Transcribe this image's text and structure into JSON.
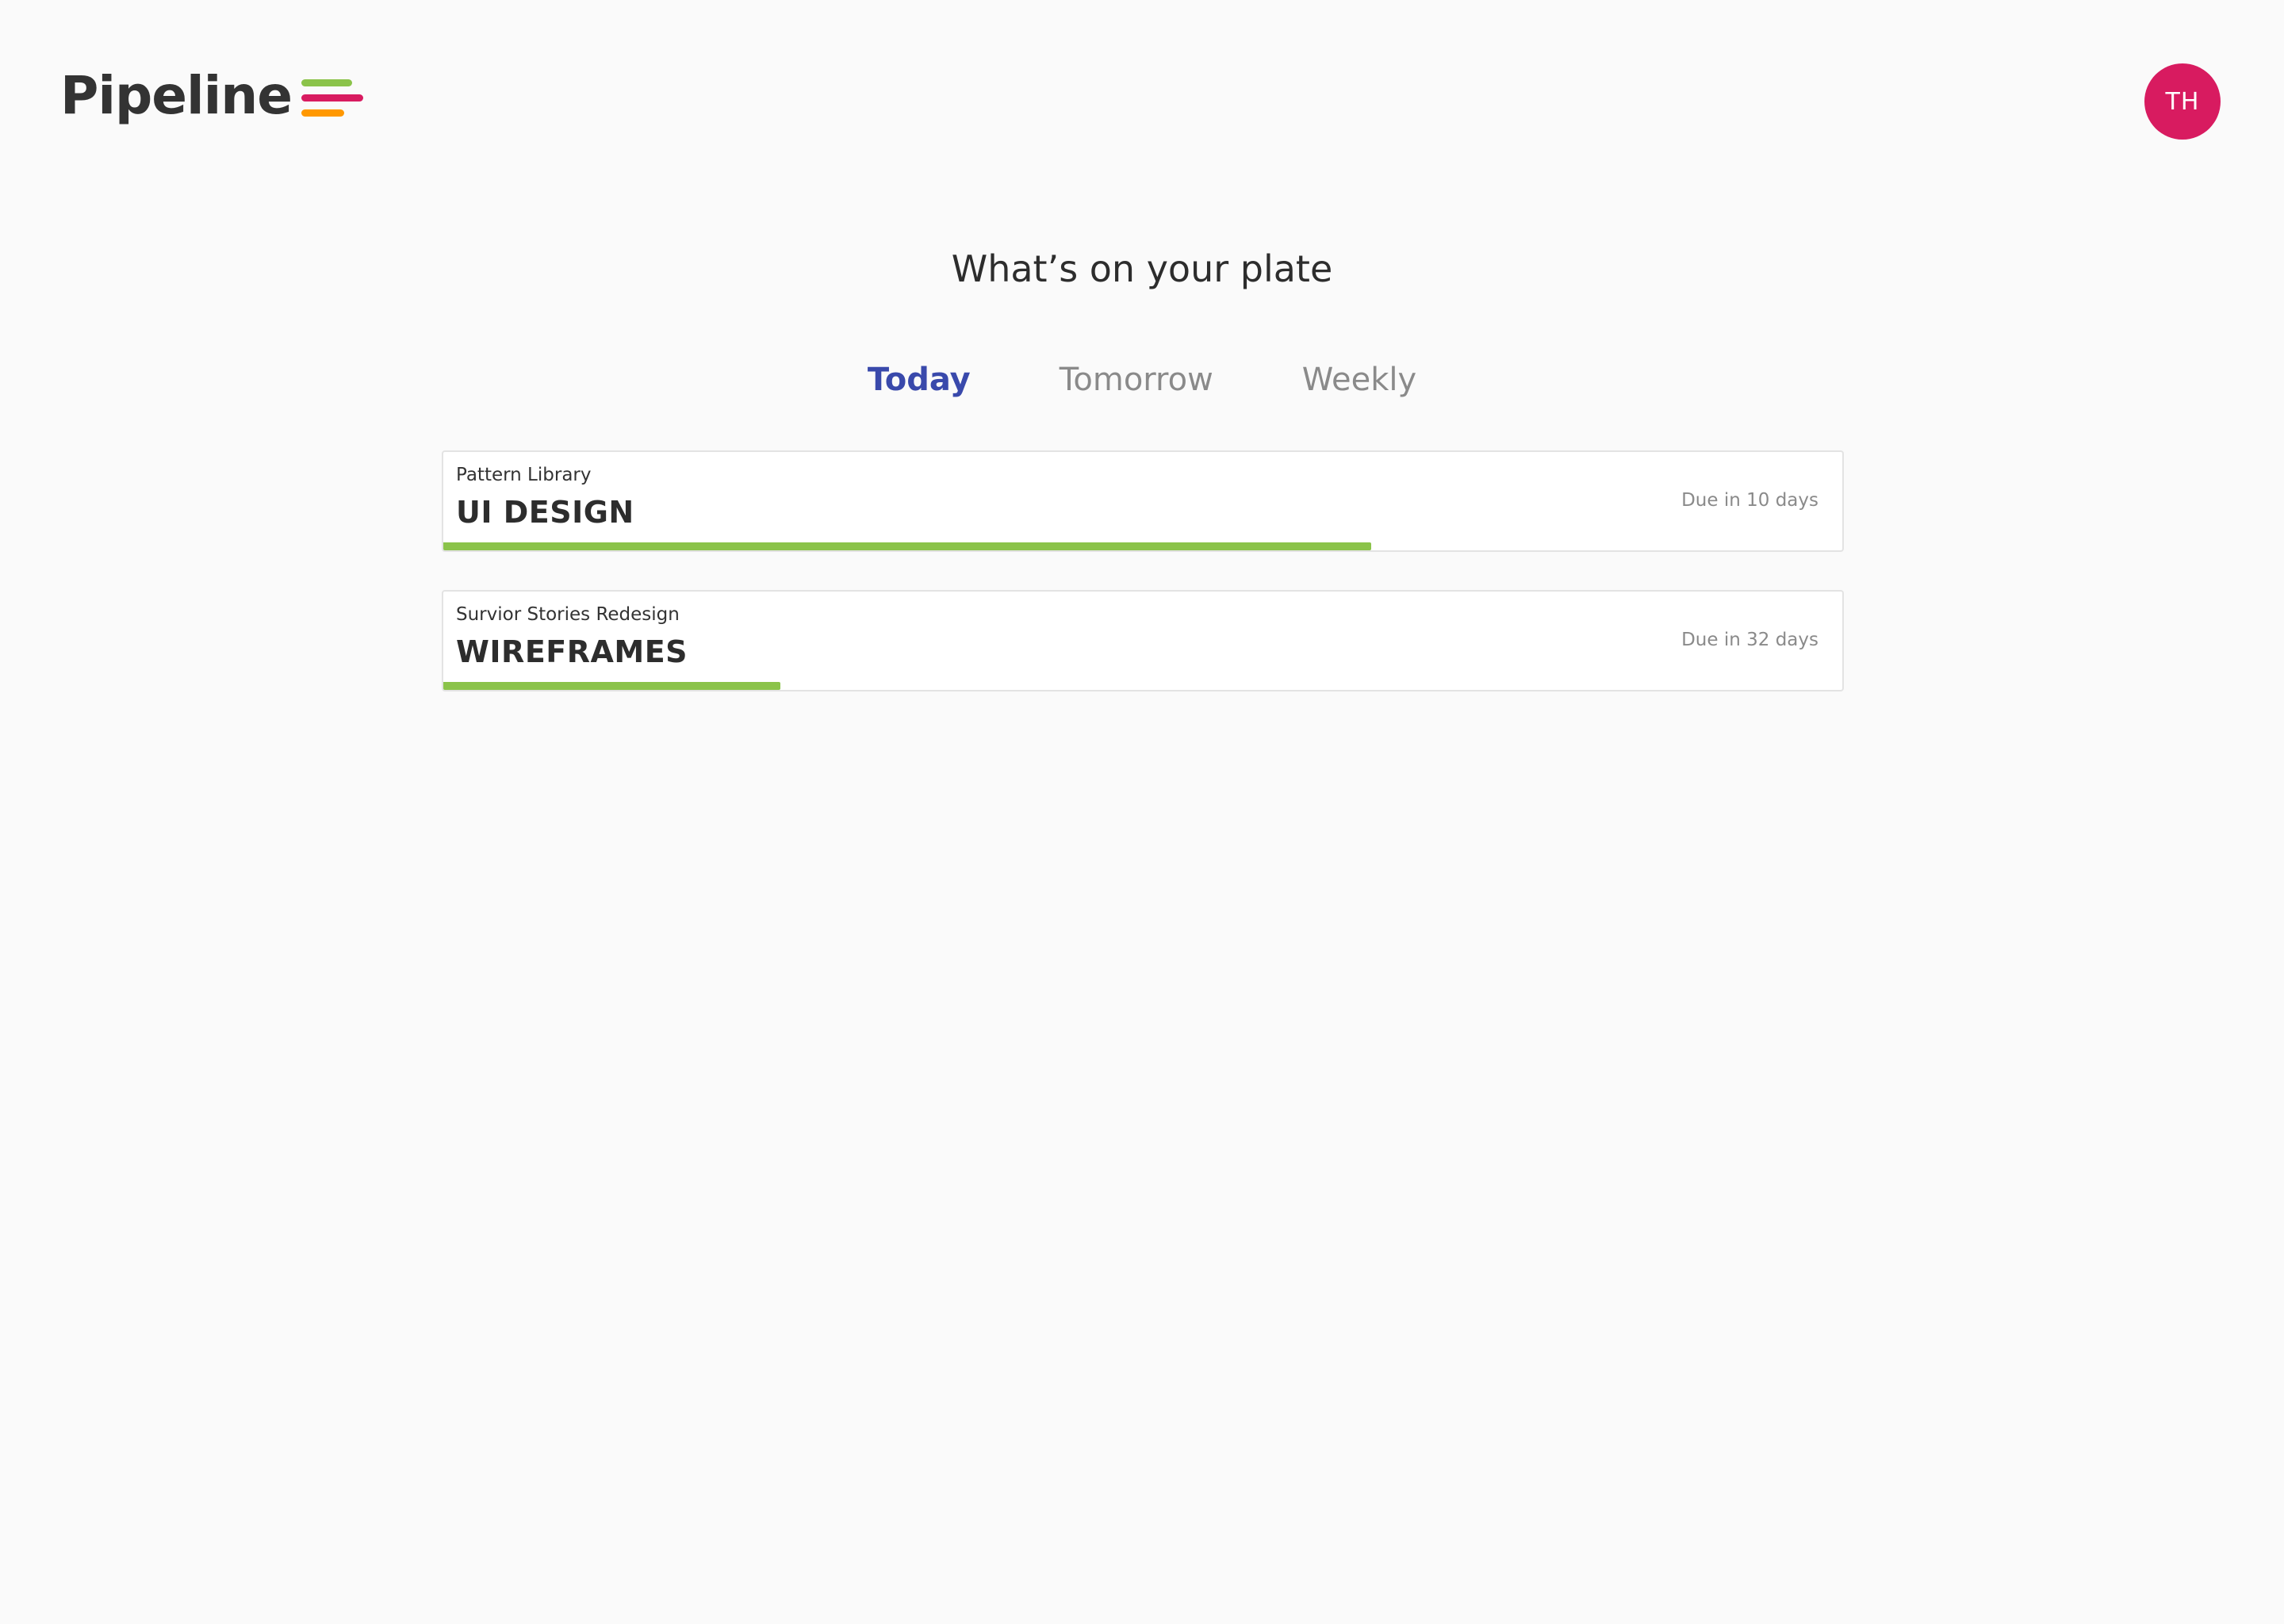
{
  "header": {
    "logo_text": "Pipeline",
    "logo_colors": [
      "#8bc34a",
      "#d81b60",
      "#ff9800"
    ],
    "avatar_initials": "TH",
    "avatar_color": "#d81b60"
  },
  "main": {
    "title": "What’s on your plate",
    "tabs": [
      {
        "label": "Today",
        "active": true
      },
      {
        "label": "Tomorrow",
        "active": false
      },
      {
        "label": "Weekly",
        "active": false
      }
    ],
    "tasks": [
      {
        "project": "Pattern Library",
        "name": "UI DESIGN",
        "due": "Due in 10 days",
        "progress": 0.663
      },
      {
        "project": "Survior Stories Redesign",
        "name": "WIREFRAMES",
        "due": "Due in 32 days",
        "progress": 0.241
      }
    ]
  },
  "colors": {
    "accent": "#3949ab",
    "progress": "#8bc34a",
    "background": "#fafafa"
  }
}
